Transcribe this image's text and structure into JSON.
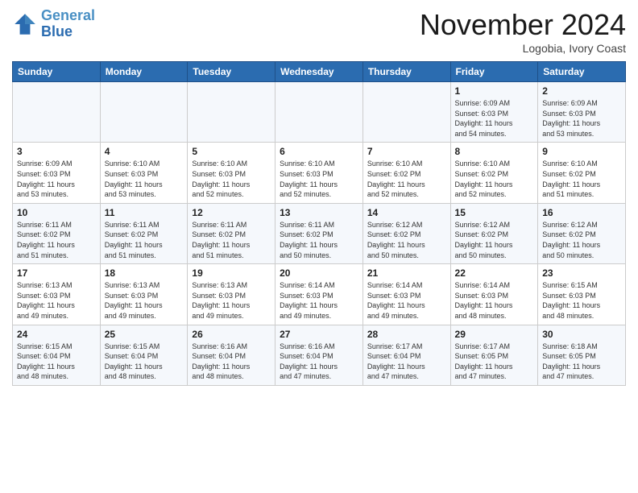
{
  "header": {
    "logo_line1": "General",
    "logo_line2": "Blue",
    "month": "November 2024",
    "location": "Logobia, Ivory Coast"
  },
  "weekdays": [
    "Sunday",
    "Monday",
    "Tuesday",
    "Wednesday",
    "Thursday",
    "Friday",
    "Saturday"
  ],
  "weeks": [
    [
      {
        "day": "",
        "info": ""
      },
      {
        "day": "",
        "info": ""
      },
      {
        "day": "",
        "info": ""
      },
      {
        "day": "",
        "info": ""
      },
      {
        "day": "",
        "info": ""
      },
      {
        "day": "1",
        "info": "Sunrise: 6:09 AM\nSunset: 6:03 PM\nDaylight: 11 hours\nand 54 minutes."
      },
      {
        "day": "2",
        "info": "Sunrise: 6:09 AM\nSunset: 6:03 PM\nDaylight: 11 hours\nand 53 minutes."
      }
    ],
    [
      {
        "day": "3",
        "info": "Sunrise: 6:09 AM\nSunset: 6:03 PM\nDaylight: 11 hours\nand 53 minutes."
      },
      {
        "day": "4",
        "info": "Sunrise: 6:10 AM\nSunset: 6:03 PM\nDaylight: 11 hours\nand 53 minutes."
      },
      {
        "day": "5",
        "info": "Sunrise: 6:10 AM\nSunset: 6:03 PM\nDaylight: 11 hours\nand 52 minutes."
      },
      {
        "day": "6",
        "info": "Sunrise: 6:10 AM\nSunset: 6:03 PM\nDaylight: 11 hours\nand 52 minutes."
      },
      {
        "day": "7",
        "info": "Sunrise: 6:10 AM\nSunset: 6:02 PM\nDaylight: 11 hours\nand 52 minutes."
      },
      {
        "day": "8",
        "info": "Sunrise: 6:10 AM\nSunset: 6:02 PM\nDaylight: 11 hours\nand 52 minutes."
      },
      {
        "day": "9",
        "info": "Sunrise: 6:10 AM\nSunset: 6:02 PM\nDaylight: 11 hours\nand 51 minutes."
      }
    ],
    [
      {
        "day": "10",
        "info": "Sunrise: 6:11 AM\nSunset: 6:02 PM\nDaylight: 11 hours\nand 51 minutes."
      },
      {
        "day": "11",
        "info": "Sunrise: 6:11 AM\nSunset: 6:02 PM\nDaylight: 11 hours\nand 51 minutes."
      },
      {
        "day": "12",
        "info": "Sunrise: 6:11 AM\nSunset: 6:02 PM\nDaylight: 11 hours\nand 51 minutes."
      },
      {
        "day": "13",
        "info": "Sunrise: 6:11 AM\nSunset: 6:02 PM\nDaylight: 11 hours\nand 50 minutes."
      },
      {
        "day": "14",
        "info": "Sunrise: 6:12 AM\nSunset: 6:02 PM\nDaylight: 11 hours\nand 50 minutes."
      },
      {
        "day": "15",
        "info": "Sunrise: 6:12 AM\nSunset: 6:02 PM\nDaylight: 11 hours\nand 50 minutes."
      },
      {
        "day": "16",
        "info": "Sunrise: 6:12 AM\nSunset: 6:02 PM\nDaylight: 11 hours\nand 50 minutes."
      }
    ],
    [
      {
        "day": "17",
        "info": "Sunrise: 6:13 AM\nSunset: 6:03 PM\nDaylight: 11 hours\nand 49 minutes."
      },
      {
        "day": "18",
        "info": "Sunrise: 6:13 AM\nSunset: 6:03 PM\nDaylight: 11 hours\nand 49 minutes."
      },
      {
        "day": "19",
        "info": "Sunrise: 6:13 AM\nSunset: 6:03 PM\nDaylight: 11 hours\nand 49 minutes."
      },
      {
        "day": "20",
        "info": "Sunrise: 6:14 AM\nSunset: 6:03 PM\nDaylight: 11 hours\nand 49 minutes."
      },
      {
        "day": "21",
        "info": "Sunrise: 6:14 AM\nSunset: 6:03 PM\nDaylight: 11 hours\nand 49 minutes."
      },
      {
        "day": "22",
        "info": "Sunrise: 6:14 AM\nSunset: 6:03 PM\nDaylight: 11 hours\nand 48 minutes."
      },
      {
        "day": "23",
        "info": "Sunrise: 6:15 AM\nSunset: 6:03 PM\nDaylight: 11 hours\nand 48 minutes."
      }
    ],
    [
      {
        "day": "24",
        "info": "Sunrise: 6:15 AM\nSunset: 6:04 PM\nDaylight: 11 hours\nand 48 minutes."
      },
      {
        "day": "25",
        "info": "Sunrise: 6:15 AM\nSunset: 6:04 PM\nDaylight: 11 hours\nand 48 minutes."
      },
      {
        "day": "26",
        "info": "Sunrise: 6:16 AM\nSunset: 6:04 PM\nDaylight: 11 hours\nand 48 minutes."
      },
      {
        "day": "27",
        "info": "Sunrise: 6:16 AM\nSunset: 6:04 PM\nDaylight: 11 hours\nand 47 minutes."
      },
      {
        "day": "28",
        "info": "Sunrise: 6:17 AM\nSunset: 6:04 PM\nDaylight: 11 hours\nand 47 minutes."
      },
      {
        "day": "29",
        "info": "Sunrise: 6:17 AM\nSunset: 6:05 PM\nDaylight: 11 hours\nand 47 minutes."
      },
      {
        "day": "30",
        "info": "Sunrise: 6:18 AM\nSunset: 6:05 PM\nDaylight: 11 hours\nand 47 minutes."
      }
    ]
  ]
}
